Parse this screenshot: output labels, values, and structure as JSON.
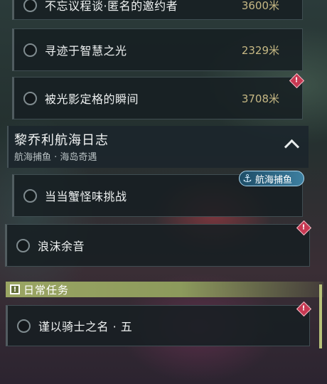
{
  "quest_list": {
    "tasks_top": [
      {
        "name": "不忘议程谈·匿名的邀约者",
        "distance": "3600米"
      },
      {
        "name": "寻迹于智慧之光",
        "distance": "2329米"
      },
      {
        "name": "被光影定格的瞬间",
        "distance": "3708米"
      }
    ],
    "group": {
      "title": "黎乔利航海日志",
      "subtitle": "航海捕鱼 · 海岛奇遇",
      "tag": "航海捕鱼",
      "tasks": [
        {
          "name": "当当蟹怪味挑战"
        },
        {
          "name": "浪沫余音"
        }
      ]
    },
    "daily": {
      "title": "日常任务",
      "tasks": [
        {
          "name": "谨以骑士之名 · 五"
        }
      ]
    }
  },
  "icons": {
    "alert": "exclamation-diamond-icon",
    "collapse": "chevron-up-icon",
    "fishing": "anchor-icon",
    "daily": "quest-board-icon"
  },
  "colors": {
    "distance": "#c6b884",
    "alert": "#c73852",
    "daily_bar": "#9aa563",
    "tag": "#2f6f8f"
  }
}
